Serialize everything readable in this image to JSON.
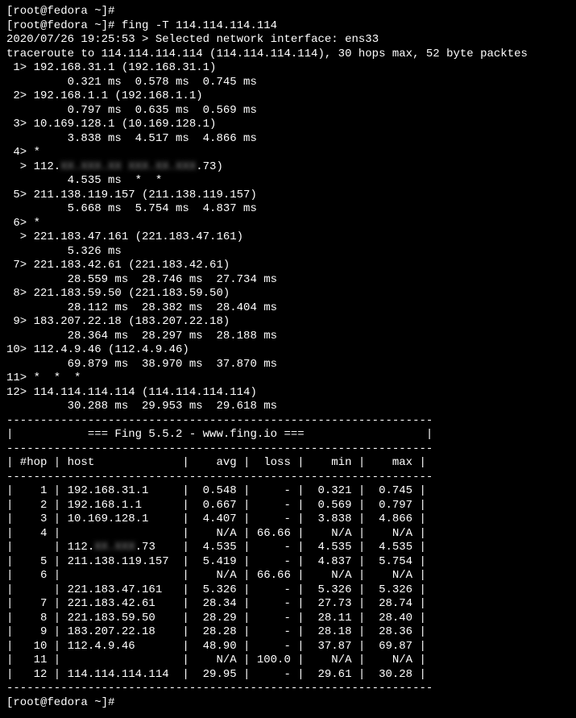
{
  "prompt_user": "root",
  "prompt_host": "fedora",
  "prompt_path": "~",
  "prompt_prefix": "[root@fedora ~]#",
  "command": "fing -T 114.114.114.114",
  "header": {
    "ts": "2020/07/26 19:25:53",
    "iface_line": "> Selected network interface: ens33",
    "trace_line": "traceroute to 114.114.114.114 (114.114.114.114), 30 hops max, 52 byte packtes"
  },
  "hops": [
    {
      "n": "1>",
      "host": "192.168.31.1 (192.168.31.1)",
      "times": "0.321 ms  0.578 ms  0.745 ms"
    },
    {
      "n": "2>",
      "host": "192.168.1.1 (192.168.1.1)",
      "times": "0.797 ms  0.635 ms  0.569 ms"
    },
    {
      "n": "3>",
      "host": "10.169.128.1 (10.169.128.1)",
      "times": "3.838 ms  4.517 ms  4.866 ms"
    },
    {
      "n": "4>",
      "host": "*",
      "times": ""
    },
    {
      "n": " >",
      "host_pre": "112.",
      "host_blur": "XX.XXX.XX XXX.XX.XXX",
      "host_post": ".73)",
      "times": "4.535 ms  *  *",
      "blurred": true
    },
    {
      "n": "5>",
      "host": "211.138.119.157 (211.138.119.157)",
      "times": "5.668 ms  5.754 ms  4.837 ms"
    },
    {
      "n": "6>",
      "host": "*",
      "times": ""
    },
    {
      "n": " >",
      "host": "221.183.47.161 (221.183.47.161)",
      "times": "5.326 ms"
    },
    {
      "n": "7>",
      "host": "221.183.42.61 (221.183.42.61)",
      "times": "28.559 ms  28.746 ms  27.734 ms"
    },
    {
      "n": "8>",
      "host": "221.183.59.50 (221.183.59.50)",
      "times": "28.112 ms  28.382 ms  28.404 ms"
    },
    {
      "n": "9>",
      "host": "183.207.22.18 (183.207.22.18)",
      "times": "28.364 ms  28.297 ms  28.188 ms"
    },
    {
      "n": "10>",
      "host": "112.4.9.46 (112.4.9.46)",
      "times": "69.879 ms  38.970 ms  37.870 ms"
    },
    {
      "n": "11>",
      "host": "*  *  *",
      "times": ""
    },
    {
      "n": "12>",
      "host": "114.114.114.114 (114.114.114.114)",
      "times": "30.288 ms  29.953 ms  29.618 ms"
    }
  ],
  "table": {
    "rule": "---------------------------------------------------------------",
    "title": "|           === Fing 5.5.2 - www.fing.io ===                  |",
    "head": "| #hop | host             |    avg |  loss |    min |    max |",
    "rows": [
      "|    1 | 192.168.31.1     |  0.548 |     - |  0.321 |  0.745 |",
      "|    2 | 192.168.1.1      |  0.667 |     - |  0.569 |  0.797 |",
      "|    3 | 10.169.128.1     |  4.407 |     - |  3.838 |  4.866 |",
      "|    4 |                  |    N/A | 66.66 |    N/A |    N/A |",
      "|      | 112.XX.XXX.73    |  4.535 |     - |  4.535 |  4.535 |",
      "|    5 | 211.138.119.157  |  5.419 |     - |  4.837 |  5.754 |",
      "|    6 |                  |    N/A | 66.66 |    N/A |    N/A |",
      "|      | 221.183.47.161   |  5.326 |     - |  5.326 |  5.326 |",
      "|    7 | 221.183.42.61    |  28.34 |     - |  27.73 |  28.74 |",
      "|    8 | 221.183.59.50    |  28.29 |     - |  28.11 |  28.40 |",
      "|    9 | 183.207.22.18    |  28.28 |     - |  28.18 |  28.36 |",
      "|   10 | 112.4.9.46       |  48.90 |     - |  37.87 |  69.87 |",
      "|   11 |                  |    N/A | 100.0 |    N/A |    N/A |",
      "|   12 | 114.114.114.114  |  29.95 |     - |  29.61 |  30.28 |"
    ]
  },
  "chart_data": {
    "type": "table",
    "title": "Fing 5.5.2 - www.fing.io",
    "columns": [
      "#hop",
      "host",
      "avg",
      "loss",
      "min",
      "max"
    ],
    "rows": [
      [
        1,
        "192.168.31.1",
        0.548,
        null,
        0.321,
        0.745
      ],
      [
        2,
        "192.168.1.1",
        0.667,
        null,
        0.569,
        0.797
      ],
      [
        3,
        "10.169.128.1",
        4.407,
        null,
        3.838,
        4.866
      ],
      [
        4,
        "",
        null,
        66.66,
        null,
        null
      ],
      [
        null,
        "112.XX.XXX.73",
        4.535,
        null,
        4.535,
        4.535
      ],
      [
        5,
        "211.138.119.157",
        5.419,
        null,
        4.837,
        5.754
      ],
      [
        6,
        "",
        null,
        66.66,
        null,
        null
      ],
      [
        null,
        "221.183.47.161",
        5.326,
        null,
        5.326,
        5.326
      ],
      [
        7,
        "221.183.42.61",
        28.34,
        null,
        27.73,
        28.74
      ],
      [
        8,
        "221.183.59.50",
        28.29,
        null,
        28.11,
        28.4
      ],
      [
        9,
        "183.207.22.18",
        28.28,
        null,
        28.18,
        28.36
      ],
      [
        10,
        "112.4.9.46",
        48.9,
        null,
        37.87,
        69.87
      ],
      [
        11,
        "",
        null,
        100.0,
        null,
        null
      ],
      [
        12,
        "114.114.114.114",
        29.95,
        null,
        29.61,
        30.28
      ]
    ]
  }
}
